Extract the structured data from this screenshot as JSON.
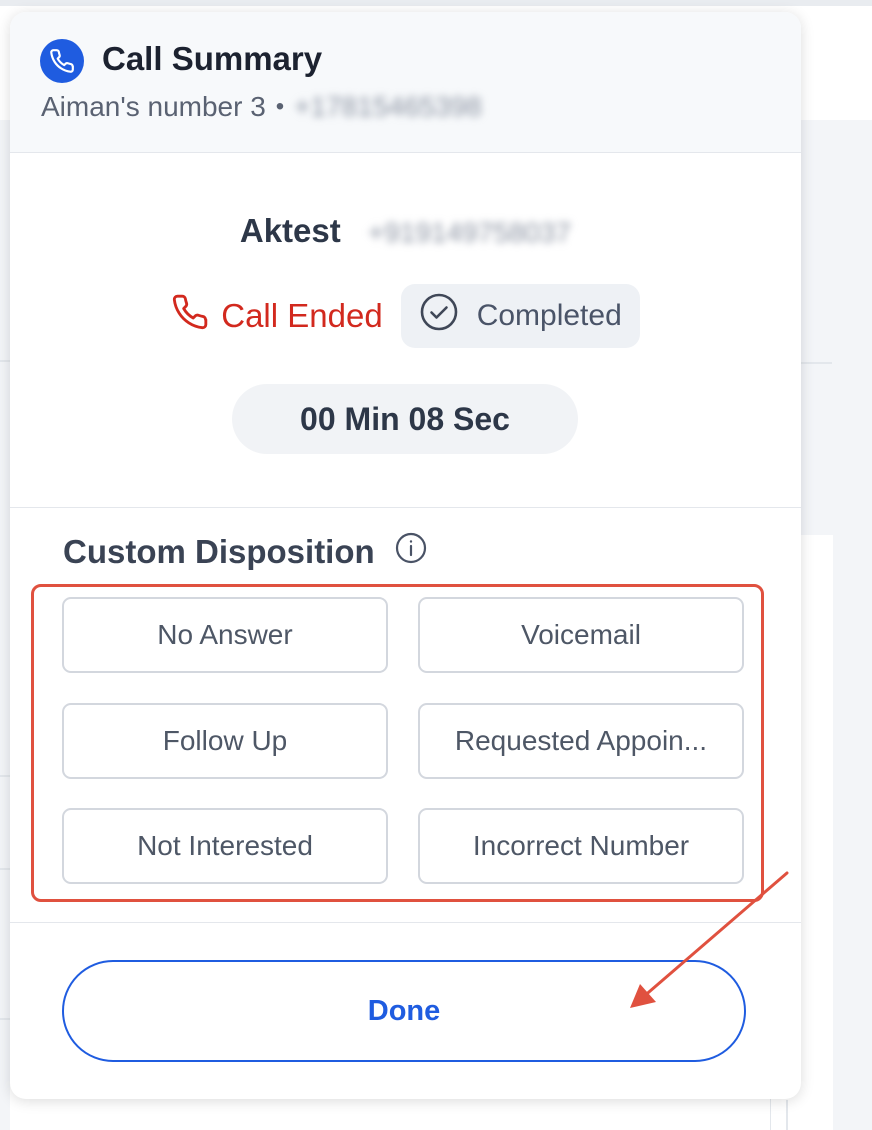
{
  "header": {
    "title": "Call Summary",
    "line_name": "Aiman's number 3",
    "separator": "•",
    "line_number": "+17815465398"
  },
  "contact": {
    "name": "Aktest",
    "number": "+919149758037"
  },
  "status": {
    "call_state": "Call Ended",
    "outcome": "Completed"
  },
  "duration": "00 Min 08 Sec",
  "disposition": {
    "title": "Custom Disposition",
    "options": [
      "No Answer",
      "Voicemail",
      "Follow Up",
      "Requested Appoin...",
      "Not Interested",
      "Incorrect Number"
    ]
  },
  "actions": {
    "done_label": "Done"
  },
  "colors": {
    "brand_blue": "#1f5ce0",
    "call_ended_red": "#d2291e",
    "annotation_red": "#e0513f"
  }
}
